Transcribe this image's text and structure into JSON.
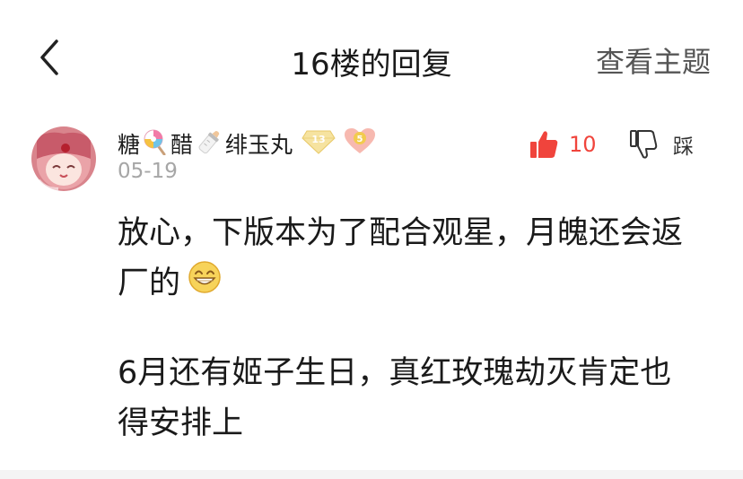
{
  "header": {
    "title": "16楼的回复",
    "view_topic": "查看主题"
  },
  "reply": {
    "username_parts": [
      "糖",
      "醋",
      "绯玉丸"
    ],
    "level_badge": "13",
    "fan_badge": "5",
    "date": "05-19",
    "likes": "10",
    "dislike_label": "踩",
    "paragraphs": [
      "放心，下版本为了配合观星，月魄还会返厂的",
      "6月还有姬子生日，真红玫瑰劫灭肯定也得安排上"
    ]
  },
  "colors": {
    "like_red": "#f0443c",
    "date_gray": "#a6a6a6",
    "badge_gold": "#f1d46a"
  }
}
